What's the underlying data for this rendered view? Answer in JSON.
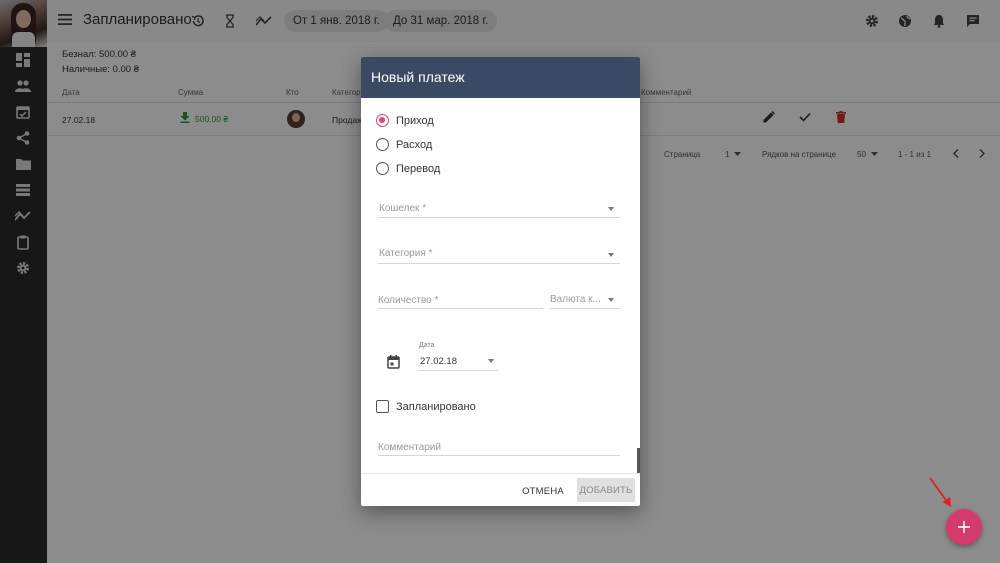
{
  "header": {
    "title": "Запланировано",
    "date_from": "От 1 янв. 2018 г.",
    "date_to": "До 31 мар. 2018 г."
  },
  "summary": {
    "cashless": "Безнал: 500.00 ₴",
    "cash": "Наличные: 0.00 ₴"
  },
  "table": {
    "columns": [
      "Дата",
      "Сумма",
      "Кто",
      "Категор",
      "Комментарий"
    ],
    "rows": [
      {
        "date": "27.02.18",
        "amount": "500.00 ₴",
        "category": "Продаж"
      }
    ]
  },
  "pagination": {
    "page_label": "Страница",
    "page": "1",
    "rows_label": "Рядков на странице",
    "rows_per_page": "50",
    "range": "1 - 1 из 1"
  },
  "dialog": {
    "title": "Новый платеж",
    "radios": [
      "Приход",
      "Расход",
      "Перевод"
    ],
    "selected": "Приход",
    "wallet_label": "Кошелек",
    "category_label": "Категория",
    "quantity_label": "Количество",
    "currency_label": "Валюта к...",
    "date_label": "Дата",
    "date_value": "27.02.18",
    "planned_label": "Запланировано",
    "comment_placeholder": "Комментарий",
    "cancel": "ОТМЕНА",
    "add": "ДОБАВИТЬ"
  },
  "colors": {
    "accent": "#e0447a",
    "dialog_header": "#3b4a64",
    "fab": "#d43a6c",
    "sidebar": "#2b2b2b"
  }
}
